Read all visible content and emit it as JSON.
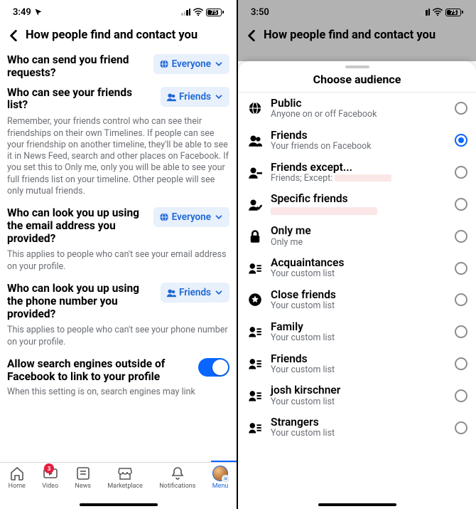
{
  "left": {
    "status": {
      "time": "3:49",
      "battery": "75"
    },
    "header": {
      "title": "How people find and contact you"
    },
    "settings": {
      "friend_requests": {
        "label": "Who can send you friend requests?",
        "value": "Everyone"
      },
      "friends_list": {
        "label": "Who can see your friends list?",
        "value": "Friends",
        "helper": "Remember, your friends control who can see their friendships on their own Timelines. If people can see your friendship on another timeline, they'll be able to see it in News Feed, search and other places on Facebook. If you set this to Only me, only you will be able to see your full friends list on your timeline. Other people will see only mutual friends."
      },
      "lookup_email": {
        "label": "Who can look you up using the email address you provided?",
        "value": "Everyone",
        "helper": "This applies to people who can't see your email address on your profile."
      },
      "lookup_phone": {
        "label": "Who can look you up using the phone number you provided?",
        "value": "Friends",
        "helper": "This applies to people who can't see your phone number on your profile."
      },
      "search_engines": {
        "label": "Allow search engines outside of Facebook to link to your profile",
        "helper": "When this setting is on, search engines may link"
      }
    },
    "tabs": {
      "home": "Home",
      "video": "Video",
      "video_badge": "3",
      "news": "News",
      "marketplace": "Marketplace",
      "notifications": "Notifications",
      "menu": "Menu"
    }
  },
  "right": {
    "status": {
      "time": "3:50",
      "battery": "75"
    },
    "header": {
      "title": "How people find and contact you"
    },
    "sheet": {
      "title": "Choose audience",
      "options": [
        {
          "name": "Public",
          "sub": "Anyone on or off Facebook",
          "icon": "globe",
          "selected": false
        },
        {
          "name": "Friends",
          "sub": "Your friends on Facebook",
          "icon": "friends",
          "selected": true
        },
        {
          "name": "Friends except...",
          "sub": "Friends; Except:",
          "icon": "friends-except",
          "selected": false,
          "redact_after": true
        },
        {
          "name": "Specific friends",
          "sub": "",
          "icon": "specific",
          "selected": false,
          "redact_sub": true
        },
        {
          "name": "Only me",
          "sub": "Only me",
          "icon": "lock",
          "selected": false
        },
        {
          "name": "Acquaintances",
          "sub": "Your custom list",
          "icon": "list",
          "selected": false
        },
        {
          "name": "Close friends",
          "sub": "Your custom list",
          "icon": "star",
          "selected": false
        },
        {
          "name": "Family",
          "sub": "Your custom list",
          "icon": "list",
          "selected": false
        },
        {
          "name": "Friends",
          "sub": "Your custom list",
          "icon": "list",
          "selected": false
        },
        {
          "name": "josh kirschner",
          "sub": "Your custom list",
          "icon": "list",
          "selected": false
        },
        {
          "name": "Strangers",
          "sub": "Your custom list",
          "icon": "list",
          "selected": false
        }
      ]
    }
  }
}
